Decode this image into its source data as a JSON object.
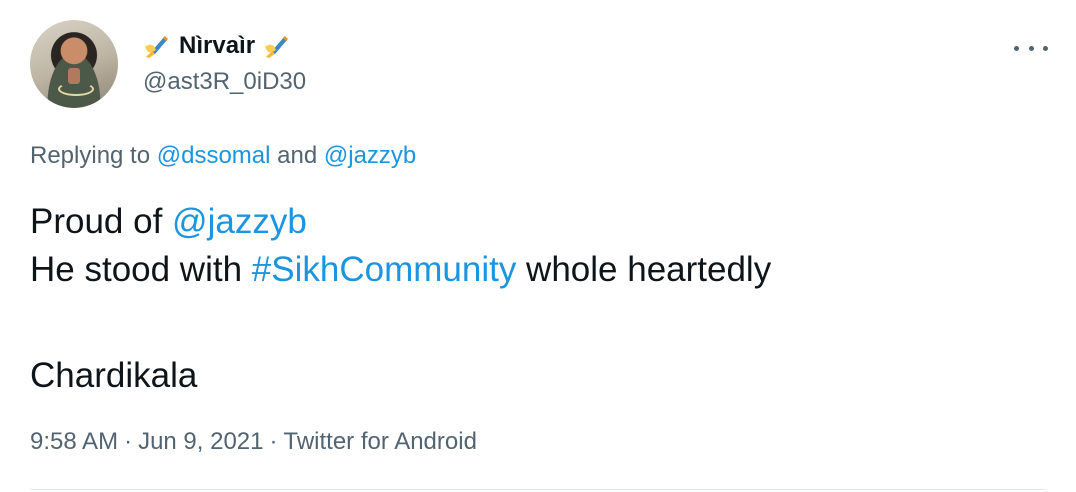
{
  "author": {
    "name": "Nìrvaìr",
    "handle": "@ast3R_0iD30",
    "name_prefix_icon": "writing-hand-emoji",
    "name_suffix_icon": "writing-hand-emoji"
  },
  "menu": {
    "icon": "more-horizontal-icon"
  },
  "reply": {
    "prefix": "Replying to ",
    "mention1": "@dssomal",
    "conjunction": " and ",
    "mention2": "@jazzyb"
  },
  "tweet": {
    "line1_text": "Proud of ",
    "line1_mention": "@jazzyb",
    "line2_text_before": "He stood with ",
    "line2_hashtag": "#SikhCommunity",
    "line2_text_after": " whole heartedly",
    "line3_text": "Chardikala"
  },
  "meta": {
    "time": "9:58 AM",
    "separator": "·",
    "date": "Jun 9, 2021",
    "source": "Twitter for Android"
  },
  "colors": {
    "link": "#1b95e0",
    "secondary_text": "#536471",
    "primary_text": "#0f1419",
    "divider": "#e1e8ed"
  }
}
